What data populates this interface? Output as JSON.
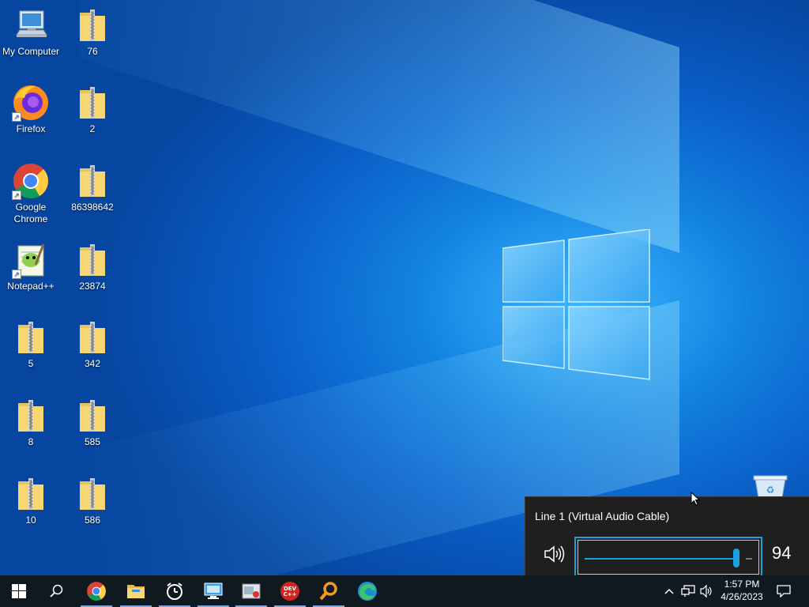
{
  "desktop": {
    "icons": [
      {
        "label": "My Computer",
        "icon": "computer-icon"
      },
      {
        "label": "76",
        "icon": "zip-folder-icon"
      },
      {
        "label": "Firefox",
        "icon": "firefox-icon"
      },
      {
        "label": "2",
        "icon": "zip-folder-icon"
      },
      {
        "label": "Google Chrome",
        "icon": "chrome-icon"
      },
      {
        "label": "86398642",
        "icon": "zip-folder-icon"
      },
      {
        "label": "Notepad++",
        "icon": "notepadpp-icon"
      },
      {
        "label": "23874",
        "icon": "zip-folder-icon"
      },
      {
        "label": "5",
        "icon": "zip-folder-icon"
      },
      {
        "label": "342",
        "icon": "zip-folder-icon"
      },
      {
        "label": "8",
        "icon": "zip-folder-icon"
      },
      {
        "label": "585",
        "icon": "zip-folder-icon"
      },
      {
        "label": "10",
        "icon": "zip-folder-icon"
      },
      {
        "label": "586",
        "icon": "zip-folder-icon"
      }
    ]
  },
  "volume": {
    "device_name": "Line 1 (Virtual Audio Cable)",
    "level": 94,
    "level_text": "94",
    "accent": "#1a9fe0"
  },
  "taskbar": {
    "apps": [
      "start-icon",
      "search-icon",
      "chrome-icon",
      "file-explorer-icon",
      "alarm-clock-icon",
      "remote-desktop-icon",
      "media-app-icon",
      "dev-cpp-icon",
      "search-magnifier-app-icon",
      "edge-icon"
    ],
    "dev_label": "DEV\nC++",
    "clock": {
      "time": "1:57 PM",
      "date": "4/26/2023"
    }
  },
  "colors": {
    "taskbar": "#101820",
    "flyout": "#1f1f1f"
  }
}
